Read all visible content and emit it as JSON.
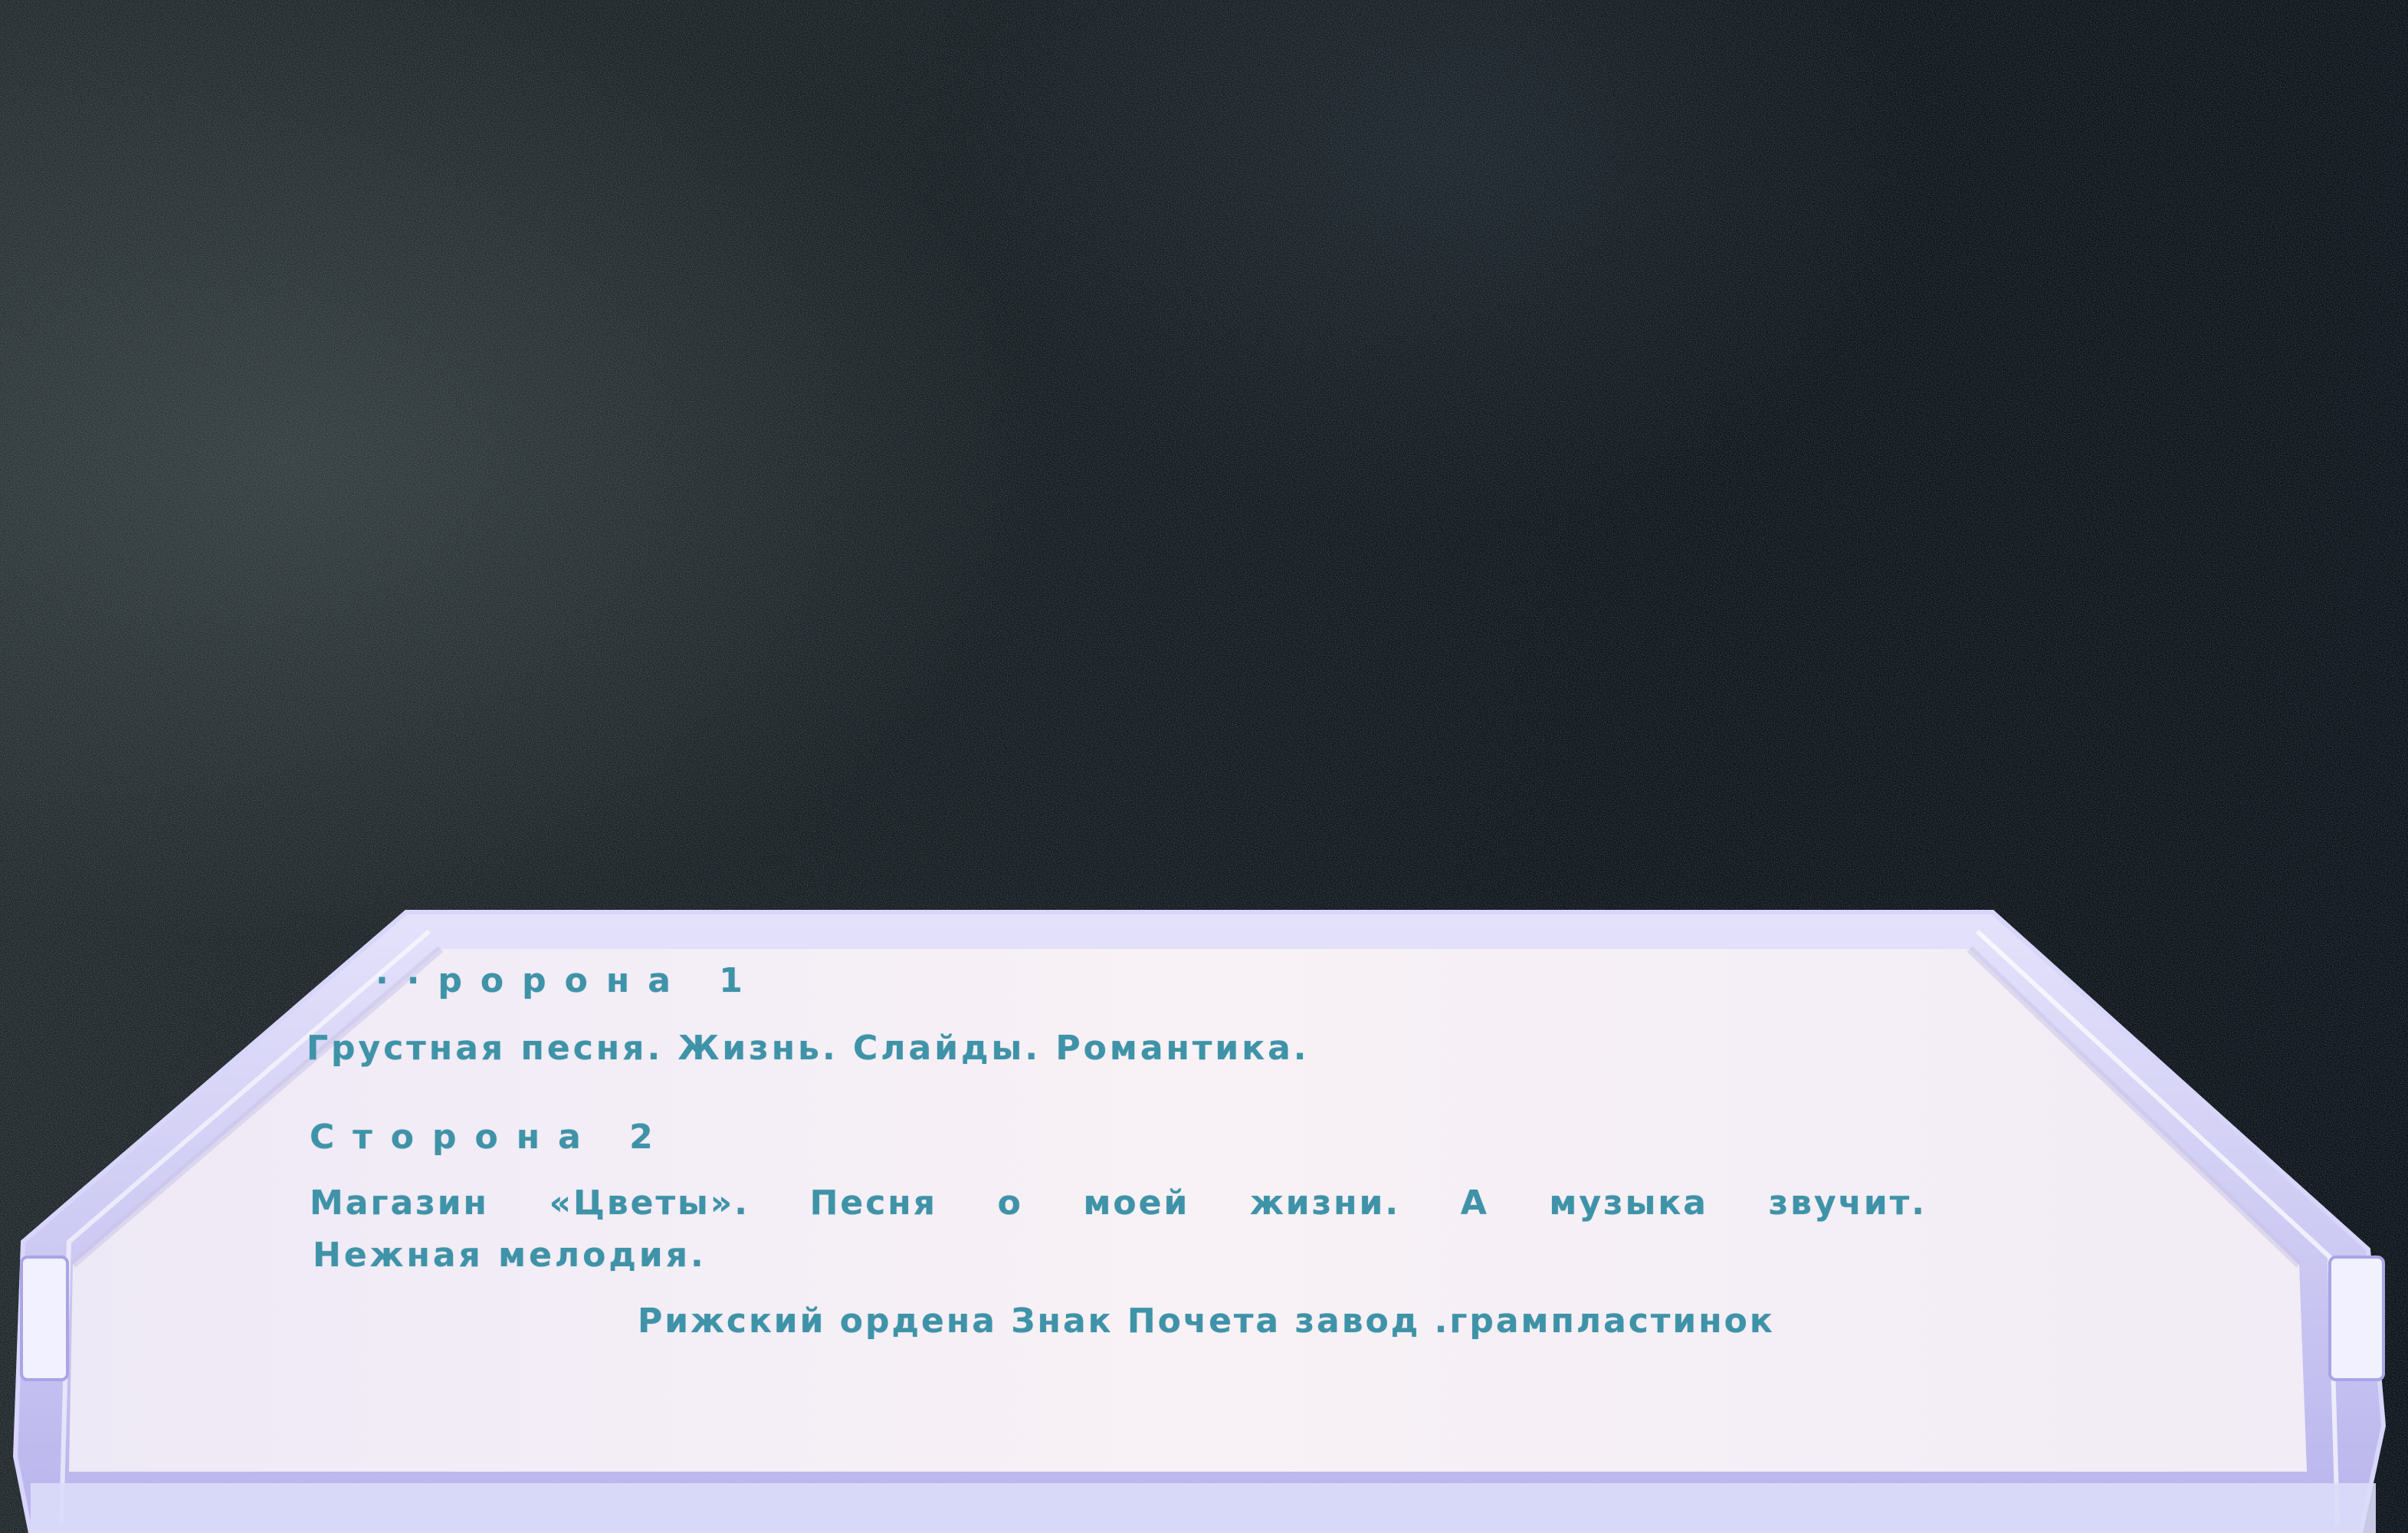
{
  "cassette_insert": {
    "side1": {
      "heading": "··ророна 1",
      "tracks": "Грустная песня. Жизнь. Слайды. Романтика."
    },
    "side2": {
      "heading": "Сторона 2",
      "tracks_line1": [
        "Магазин",
        "«Цветы».",
        "Песня",
        "о",
        "моей",
        "жизни.",
        "А",
        "музыка",
        "звучит."
      ],
      "tracks_line2": "Нежная мелодия."
    },
    "manufacturer": "Рижский ордена Знак Почета завод .грампластинок"
  },
  "colors": {
    "background_dark": "#0b0d11",
    "label_paper": "#f4eef3",
    "ink": "#3f93a8",
    "case_edge": "#c9c6f2"
  }
}
